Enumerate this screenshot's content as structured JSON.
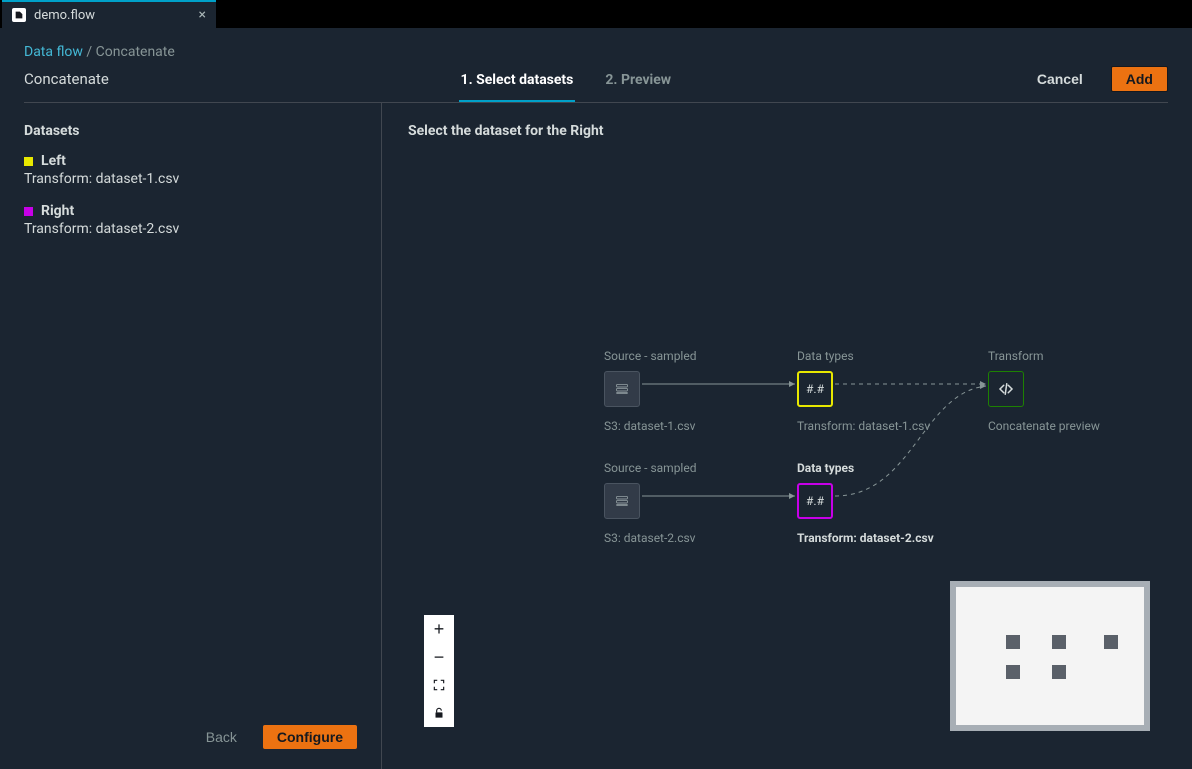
{
  "tab": {
    "title": "demo.flow"
  },
  "breadcrumb": {
    "root": "Data flow",
    "sep": " / ",
    "leaf": "Concatenate"
  },
  "page": {
    "title": "Concatenate"
  },
  "steps": [
    {
      "label": "1. Select datasets",
      "active": true
    },
    {
      "label": "2. Preview",
      "active": false
    }
  ],
  "header_actions": {
    "cancel": "Cancel",
    "add": "Add"
  },
  "sidebar": {
    "heading": "Datasets",
    "items": [
      {
        "color": "yellow",
        "name": "Left",
        "sub": "Transform: dataset-1.csv"
      },
      {
        "color": "magenta",
        "name": "Right",
        "sub": "Transform: dataset-2.csv"
      }
    ],
    "back": "Back",
    "configure": "Configure"
  },
  "canvas": {
    "instruction": "Select the dataset for the Right",
    "nodes": {
      "src1": {
        "top_label": "Source - sampled",
        "sub_label": "S3: dataset-1.csv"
      },
      "src2": {
        "top_label": "Source - sampled",
        "sub_label": "S3: dataset-2.csv"
      },
      "type1": {
        "top_label": "Data types",
        "sub_label": "Transform: dataset-1.csv",
        "glyph": "#.#"
      },
      "type2": {
        "top_label": "Data types",
        "sub_label": "Transform: dataset-2.csv",
        "glyph": "#.#"
      },
      "tfm": {
        "top_label": "Transform",
        "sub_label": "Concatenate preview"
      }
    }
  }
}
